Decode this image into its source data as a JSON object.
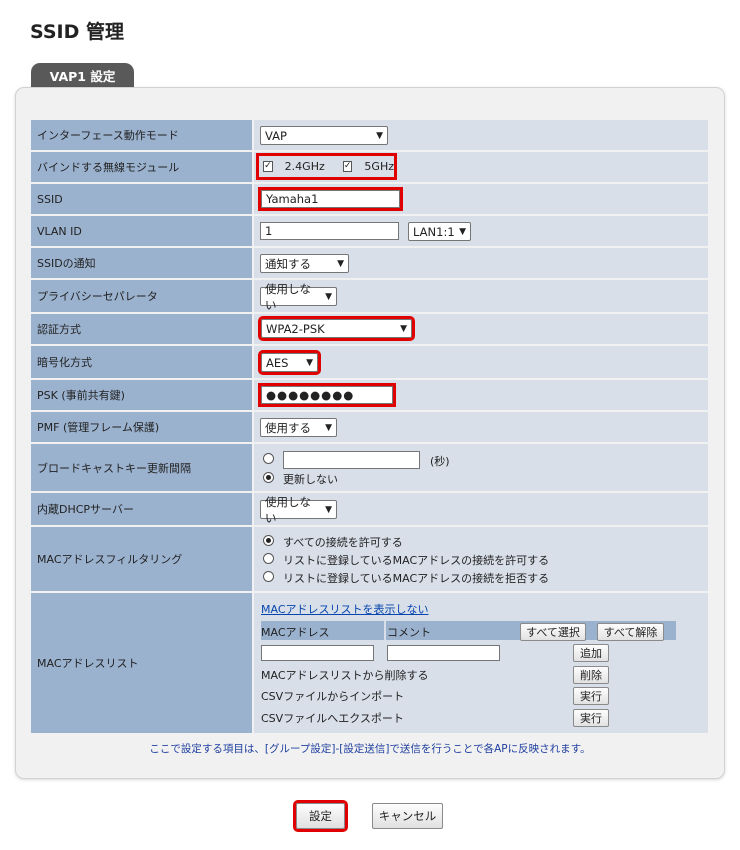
{
  "page": {
    "title": "SSID 管理",
    "tab": "VAP1 設定"
  },
  "rows": {
    "mode": {
      "label": "インターフェース動作モード",
      "value": "VAP"
    },
    "bind": {
      "label": "バインドする無線モジュール",
      "opt1": "2.4GHz",
      "opt1_checked": true,
      "opt2": "5GHz",
      "opt2_checked": true
    },
    "ssid": {
      "label": "SSID",
      "value": "Yamaha1"
    },
    "vlan": {
      "label": "VLAN ID",
      "value": "1",
      "port": "LAN1:1"
    },
    "notify": {
      "label": "SSIDの通知",
      "value": "通知する"
    },
    "privacy": {
      "label": "プライバシーセパレータ",
      "value": "使用しない"
    },
    "auth": {
      "label": "認証方式",
      "value": "WPA2-PSK"
    },
    "enc": {
      "label": "暗号化方式",
      "value": "AES"
    },
    "psk": {
      "label": "PSK (事前共有鍵)",
      "value": "●●●●●●●●"
    },
    "pmf": {
      "label": "PMF (管理フレーム保護)",
      "value": "使用する"
    },
    "broadcast": {
      "label": "ブロードキャストキー更新間隔",
      "unit": "(秒)",
      "input_value": "",
      "no_update": "更新しない",
      "selected": "no_update"
    },
    "dhcp": {
      "label": "内蔵DHCPサーバー",
      "value": "使用しない"
    },
    "macfilter": {
      "label": "MACアドレスフィルタリング",
      "options": [
        "すべての接続を許可する",
        "リストに登録しているMACアドレスの接続を許可する",
        "リストに登録しているMACアドレスの接続を拒否する"
      ],
      "selected_index": 0
    },
    "maclist": {
      "label": "MACアドレスリスト",
      "hide_link": "MACアドレスリストを表示しない",
      "col_mac": "MACアドレス",
      "col_comment": "コメント",
      "select_all": "すべて選択",
      "deselect_all": "すべて解除",
      "mac_input": "",
      "comment_input": "",
      "add": "追加",
      "remove_label": "MACアドレスリストから削除する",
      "remove": "削除",
      "import_label": "CSVファイルからインポート",
      "import_btn": "実行",
      "export_label": "CSVファイルへエクスポート",
      "export_btn": "実行"
    }
  },
  "note": "ここで設定する項目は、[グループ設定]-[設定送信]で送信を行うことで各APに反映されます。",
  "buttons": {
    "apply": "設定",
    "cancel": "キャンセル"
  },
  "colors": {
    "label_bg": "#9bb2cf",
    "value_bg": "#d8dfe9",
    "highlight": "#e00000",
    "tab_bg": "#595959"
  }
}
